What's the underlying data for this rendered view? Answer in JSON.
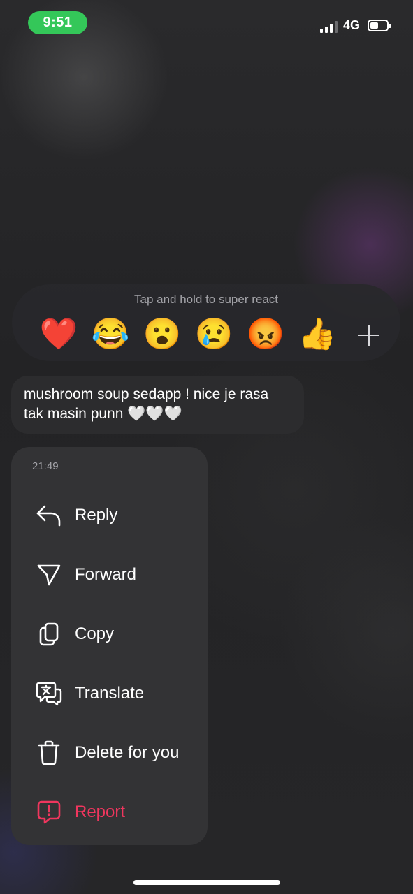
{
  "status_bar": {
    "time": "9:51",
    "network": "4G",
    "battery_level": 0.5,
    "time_pill_color": "#34c759"
  },
  "reactions": {
    "hint": "Tap and hold to super react",
    "items": [
      {
        "emoji": "❤️",
        "name": "heart"
      },
      {
        "emoji": "😂",
        "name": "joy"
      },
      {
        "emoji": "😮",
        "name": "surprised"
      },
      {
        "emoji": "😢",
        "name": "cry"
      },
      {
        "emoji": "😡",
        "name": "angry"
      },
      {
        "emoji": "👍",
        "name": "thumbs-up"
      }
    ],
    "more": "+"
  },
  "message": {
    "text": "mushroom soup sedapp ! nice je rasa tak masin punn 🤍🤍🤍"
  },
  "menu": {
    "timestamp": "21:49",
    "items": [
      {
        "label": "Reply",
        "icon": "reply-icon"
      },
      {
        "label": "Forward",
        "icon": "forward-icon"
      },
      {
        "label": "Copy",
        "icon": "copy-icon"
      },
      {
        "label": "Translate",
        "icon": "translate-icon"
      },
      {
        "label": "Delete for you",
        "icon": "trash-icon"
      },
      {
        "label": "Report",
        "icon": "report-icon",
        "color": "#f0365e"
      }
    ]
  }
}
